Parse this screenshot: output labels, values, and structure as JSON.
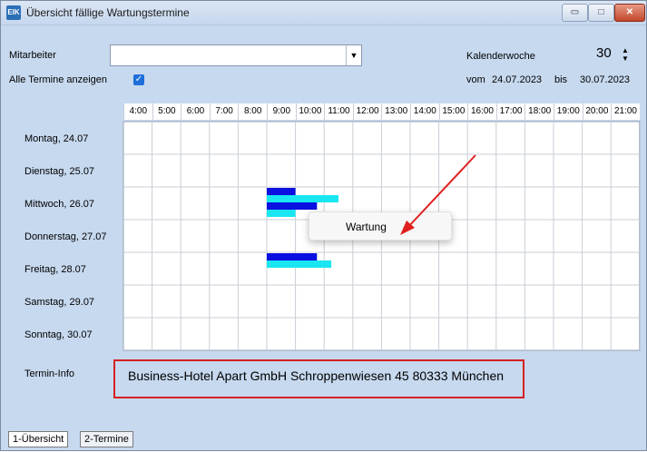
{
  "window": {
    "title": "Übersicht fällige Wartungstermine",
    "app_icon": "EIK",
    "controls": {
      "minimize": "▭",
      "maximize": "□",
      "close": "✕"
    }
  },
  "filter": {
    "employee_label": "Mitarbeiter",
    "employee_value": "",
    "show_all_label": "Alle Termine anzeigen",
    "show_all_checked": true
  },
  "week": {
    "label": "Kalenderwoche",
    "number": "30",
    "from_label": "vom",
    "from": "24.07.2023",
    "to_label": "bis",
    "to": "30.07.2023"
  },
  "schedule": {
    "hours": [
      "4:00",
      "5:00",
      "6:00",
      "7:00",
      "8:00",
      "9:00",
      "10:00",
      "11:00",
      "12:00",
      "13:00",
      "14:00",
      "15:00",
      "16:00",
      "17:00",
      "18:00",
      "19:00",
      "20:00",
      "21:00"
    ],
    "days": [
      "Montag, 24.07",
      "Dienstag, 25.07",
      "Mittwoch, 26.07",
      "Donnerstag, 27.07",
      "Freitag, 28.07",
      "Samstag, 29.07",
      "Sonntag, 30.07"
    ],
    "appointments": [
      {
        "day": 2,
        "start": "9:00",
        "end": "10:00",
        "color": "#0a10e0"
      },
      {
        "day": 2,
        "start": "9:00",
        "end": "11:30",
        "color": "#19e6f0"
      },
      {
        "day": 2,
        "start": "9:00",
        "end": "10:45",
        "color": "#0a10e0"
      },
      {
        "day": 2,
        "start": "9:00",
        "end": "10:00",
        "color": "#19e6f0"
      },
      {
        "day": 4,
        "start": "9:00",
        "end": "10:45",
        "color": "#0a10e0"
      },
      {
        "day": 4,
        "start": "9:00",
        "end": "11:15",
        "color": "#19e6f0"
      }
    ]
  },
  "tooltip": {
    "text": "Wartung"
  },
  "info": {
    "label": "Termin-Info",
    "text": "Business-Hotel Apart GmbH Schroppenwiesen 45 80333 München"
  },
  "tabs": [
    "1-Übersicht",
    "2-Termine"
  ],
  "colors": {
    "highlight": "#d42020",
    "window_bg": "#c7d9ef"
  }
}
